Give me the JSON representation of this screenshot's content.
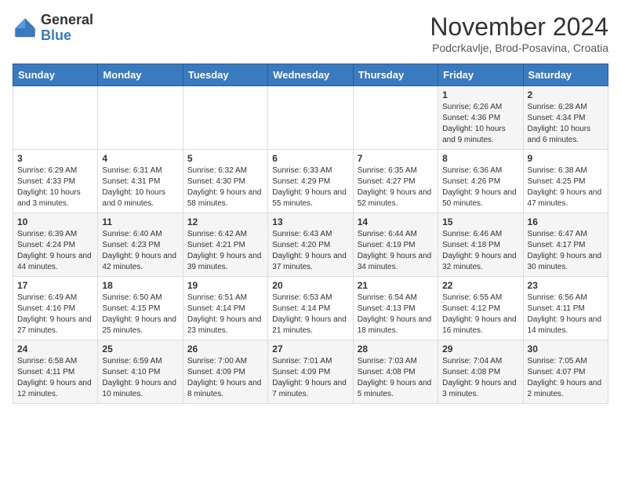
{
  "header": {
    "logo_general": "General",
    "logo_blue": "Blue",
    "title": "November 2024",
    "location": "Podcrkavlje, Brod-Posavina, Croatia"
  },
  "days_of_week": [
    "Sunday",
    "Monday",
    "Tuesday",
    "Wednesday",
    "Thursday",
    "Friday",
    "Saturday"
  ],
  "weeks": [
    [
      {
        "day": "",
        "info": ""
      },
      {
        "day": "",
        "info": ""
      },
      {
        "day": "",
        "info": ""
      },
      {
        "day": "",
        "info": ""
      },
      {
        "day": "",
        "info": ""
      },
      {
        "day": "1",
        "info": "Sunrise: 6:26 AM\nSunset: 4:36 PM\nDaylight: 10 hours and 9 minutes."
      },
      {
        "day": "2",
        "info": "Sunrise: 6:28 AM\nSunset: 4:34 PM\nDaylight: 10 hours and 6 minutes."
      }
    ],
    [
      {
        "day": "3",
        "info": "Sunrise: 6:29 AM\nSunset: 4:33 PM\nDaylight: 10 hours and 3 minutes."
      },
      {
        "day": "4",
        "info": "Sunrise: 6:31 AM\nSunset: 4:31 PM\nDaylight: 10 hours and 0 minutes."
      },
      {
        "day": "5",
        "info": "Sunrise: 6:32 AM\nSunset: 4:30 PM\nDaylight: 9 hours and 58 minutes."
      },
      {
        "day": "6",
        "info": "Sunrise: 6:33 AM\nSunset: 4:29 PM\nDaylight: 9 hours and 55 minutes."
      },
      {
        "day": "7",
        "info": "Sunrise: 6:35 AM\nSunset: 4:27 PM\nDaylight: 9 hours and 52 minutes."
      },
      {
        "day": "8",
        "info": "Sunrise: 6:36 AM\nSunset: 4:26 PM\nDaylight: 9 hours and 50 minutes."
      },
      {
        "day": "9",
        "info": "Sunrise: 6:38 AM\nSunset: 4:25 PM\nDaylight: 9 hours and 47 minutes."
      }
    ],
    [
      {
        "day": "10",
        "info": "Sunrise: 6:39 AM\nSunset: 4:24 PM\nDaylight: 9 hours and 44 minutes."
      },
      {
        "day": "11",
        "info": "Sunrise: 6:40 AM\nSunset: 4:23 PM\nDaylight: 9 hours and 42 minutes."
      },
      {
        "day": "12",
        "info": "Sunrise: 6:42 AM\nSunset: 4:21 PM\nDaylight: 9 hours and 39 minutes."
      },
      {
        "day": "13",
        "info": "Sunrise: 6:43 AM\nSunset: 4:20 PM\nDaylight: 9 hours and 37 minutes."
      },
      {
        "day": "14",
        "info": "Sunrise: 6:44 AM\nSunset: 4:19 PM\nDaylight: 9 hours and 34 minutes."
      },
      {
        "day": "15",
        "info": "Sunrise: 6:46 AM\nSunset: 4:18 PM\nDaylight: 9 hours and 32 minutes."
      },
      {
        "day": "16",
        "info": "Sunrise: 6:47 AM\nSunset: 4:17 PM\nDaylight: 9 hours and 30 minutes."
      }
    ],
    [
      {
        "day": "17",
        "info": "Sunrise: 6:49 AM\nSunset: 4:16 PM\nDaylight: 9 hours and 27 minutes."
      },
      {
        "day": "18",
        "info": "Sunrise: 6:50 AM\nSunset: 4:15 PM\nDaylight: 9 hours and 25 minutes."
      },
      {
        "day": "19",
        "info": "Sunrise: 6:51 AM\nSunset: 4:14 PM\nDaylight: 9 hours and 23 minutes."
      },
      {
        "day": "20",
        "info": "Sunrise: 6:53 AM\nSunset: 4:14 PM\nDaylight: 9 hours and 21 minutes."
      },
      {
        "day": "21",
        "info": "Sunrise: 6:54 AM\nSunset: 4:13 PM\nDaylight: 9 hours and 18 minutes."
      },
      {
        "day": "22",
        "info": "Sunrise: 6:55 AM\nSunset: 4:12 PM\nDaylight: 9 hours and 16 minutes."
      },
      {
        "day": "23",
        "info": "Sunrise: 6:56 AM\nSunset: 4:11 PM\nDaylight: 9 hours and 14 minutes."
      }
    ],
    [
      {
        "day": "24",
        "info": "Sunrise: 6:58 AM\nSunset: 4:11 PM\nDaylight: 9 hours and 12 minutes."
      },
      {
        "day": "25",
        "info": "Sunrise: 6:59 AM\nSunset: 4:10 PM\nDaylight: 9 hours and 10 minutes."
      },
      {
        "day": "26",
        "info": "Sunrise: 7:00 AM\nSunset: 4:09 PM\nDaylight: 9 hours and 8 minutes."
      },
      {
        "day": "27",
        "info": "Sunrise: 7:01 AM\nSunset: 4:09 PM\nDaylight: 9 hours and 7 minutes."
      },
      {
        "day": "28",
        "info": "Sunrise: 7:03 AM\nSunset: 4:08 PM\nDaylight: 9 hours and 5 minutes."
      },
      {
        "day": "29",
        "info": "Sunrise: 7:04 AM\nSunset: 4:08 PM\nDaylight: 9 hours and 3 minutes."
      },
      {
        "day": "30",
        "info": "Sunrise: 7:05 AM\nSunset: 4:07 PM\nDaylight: 9 hours and 2 minutes."
      }
    ]
  ]
}
